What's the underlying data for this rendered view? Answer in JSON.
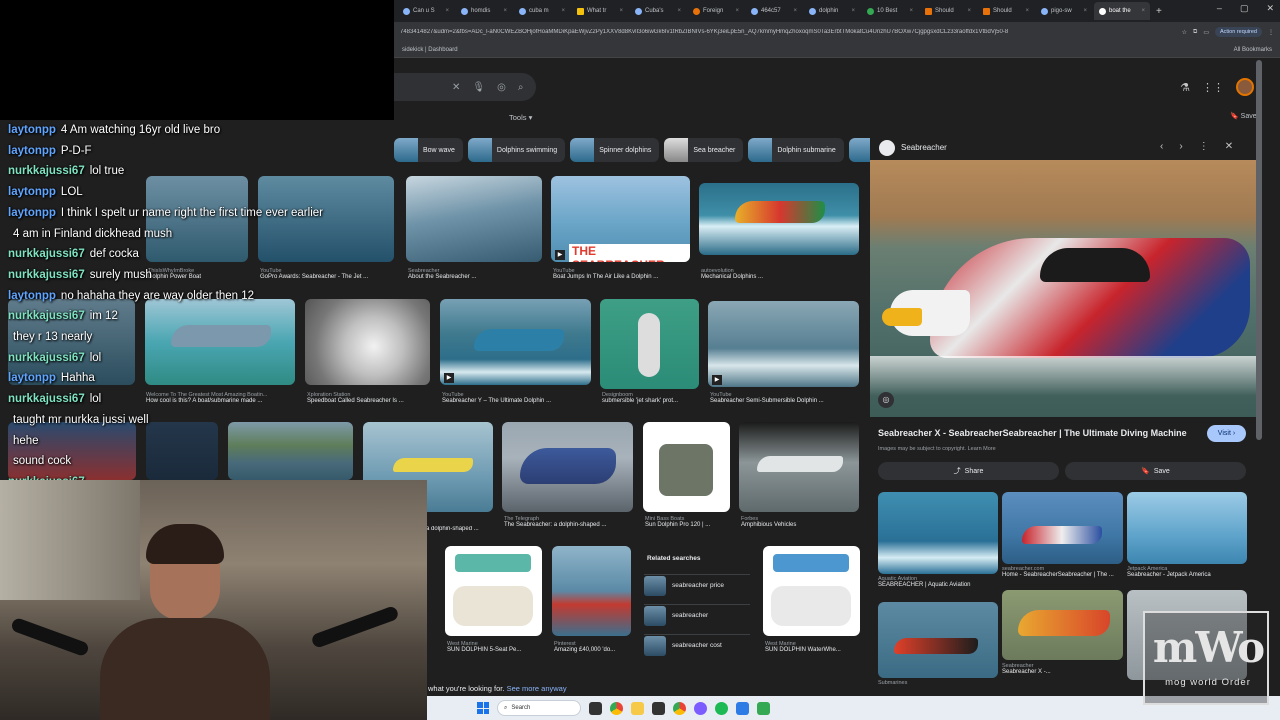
{
  "browser": {
    "tabs": [
      {
        "label": "Can u S"
      },
      {
        "label": "homdis"
      },
      {
        "label": "cuba m"
      },
      {
        "label": "What tr"
      },
      {
        "label": "Cuba's"
      },
      {
        "label": "Foreign"
      },
      {
        "label": "464c57"
      },
      {
        "label": "dolphin"
      },
      {
        "label": "10 Best"
      },
      {
        "label": "Should"
      },
      {
        "label": "Should"
      },
      {
        "label": "pigo-sw"
      },
      {
        "label": "boat the"
      }
    ],
    "url": "7483414827&udm=2&fbs=ADc_l-aN0CWEZBOHjofHoaMMDiKpaEWjvZ2Py1XXV8d8KvlI3o6iwGk6Iv1tRbZIBNIVs-6YKj3eiLpE5n_AQ7kmmyHmqZhoxoqmS0Ta3ErbtTMokatCu4UnzhU7BOXw7CjgpgsxdCLz33raoffdx1VtbdVj50-8",
    "action_required": "Action required",
    "bookmark_left": "sidekick | Dashboard",
    "bookmark_right": "All Bookmarks"
  },
  "google": {
    "tools_label": "Tools",
    "saves_label": "Saves",
    "chips": [
      {
        "label": "Bow wave"
      },
      {
        "label": "Dolphins swimming"
      },
      {
        "label": "Spinner dolphins"
      },
      {
        "label": "Sea breacher"
      },
      {
        "label": "Dolphin submarine"
      }
    ],
    "results": [
      {
        "source": "Seabreacher",
        "title": "About the Seabreacher ..."
      },
      {
        "source": "YouTube",
        "title": "Boat Jumps In The Air Like a Dolphin ...",
        "overlay": "THE SEABREACHER"
      },
      {
        "source": "autoevolution",
        "title": "Mechanical Dolphins ..."
      },
      {
        "source": "ThisIsWhyImBroke",
        "title": "Dolphin Power Boat"
      },
      {
        "source": "YouTube",
        "title": "GoPro Awards: Seabreacher - The Jet ..."
      },
      {
        "source": "Welcome To The Greatest Most Amazing Boatin...",
        "title": "How cool is this? A boat/submarine made ..."
      },
      {
        "source": "Xploration Station",
        "title": "Speedboat Called Seabreacher Is ..."
      },
      {
        "source": "YouTube",
        "title": "Seabreacher Y – The Ultimate Dolphin ..."
      },
      {
        "source": "Designboom",
        "title": "submersible 'jet shark' prot..."
      },
      {
        "source": "YouTube",
        "title": "Seabreacher Semi-Submersible Dolphin ..."
      },
      {
        "source": "",
        "title": "a dolphin-shaped ..."
      },
      {
        "source": "The Telegraph",
        "title": "The Seabreacher: a dolphin-shaped ..."
      },
      {
        "source": "Mini Bass Boats",
        "title": "Sun Dolphin Pro 120 | ..."
      },
      {
        "source": "Forbes",
        "title": "Amphibious Vehicles"
      },
      {
        "source": "West Marine",
        "title": "SUN DOLPHIN 5-Seat Pe..."
      },
      {
        "source": "Pinterest",
        "title": "Amazing £40,000 'do..."
      },
      {
        "source": "West Marine",
        "title": "SUN DOLPHIN WaterWhe..."
      }
    ],
    "related": {
      "heading": "Related searches",
      "items": [
        {
          "label": "seabreacher price"
        },
        {
          "label": "seabreacher"
        },
        {
          "label": "seabreacher cost"
        }
      ]
    },
    "footer_text": "what you're looking for.",
    "footer_link": "See more anyway"
  },
  "panel": {
    "site": "Seabreacher",
    "heading": "Seabreacher X - SeabreacherSeabreacher | The Ultimate Diving Machine",
    "visit_label": "Visit",
    "copyright": "Images may be subject to copyright. Learn More",
    "share_label": "Share",
    "save_label": "Save",
    "more": [
      {
        "source": "Aquatic Aviation",
        "title": "SEABREACHER | Aquatic Aviation"
      },
      {
        "source": "seabreacher.com",
        "title": "Home - SeabreacherSeabreacher | The ..."
      },
      {
        "source": "Jetpack America",
        "title": "Seabreacher - Jetpack America"
      },
      {
        "source": "Submarines",
        "title": ""
      },
      {
        "source": "Seabreacher",
        "title": "Seabreacher X -..."
      }
    ]
  },
  "taskbar": {
    "search_placeholder": "Search"
  },
  "chat": [
    {
      "user": "laytonpp",
      "msg": "4 Am watching 16yr old live bro",
      "color": "blue"
    },
    {
      "user": "laytonpp",
      "msg": "P-D-F",
      "color": "blue"
    },
    {
      "user": "nurkkajussi67",
      "msg": "lol true",
      "color": "green"
    },
    {
      "user": "laytonpp",
      "msg": "LOL",
      "color": "blue"
    },
    {
      "user": "laytonpp",
      "msg": "I think I spelt ur name right the first time ever earlier",
      "color": "blue"
    },
    {
      "user": "",
      "msg": "4 am in Finland dickhead mush",
      "color": "blue"
    },
    {
      "user": "nurkkajussi67",
      "msg": "def cocka",
      "color": "green"
    },
    {
      "user": "nurkkajussi67",
      "msg": "surely mush",
      "color": "green"
    },
    {
      "user": "laytonpp",
      "msg": "no hahaha they are way older then 12",
      "color": "blue"
    },
    {
      "user": "nurkkajussi67",
      "msg": "im 12",
      "color": "green"
    },
    {
      "user": "",
      "msg": "they r 13 nearly",
      "color": "blue"
    },
    {
      "user": "nurkkajussi67",
      "msg": "lol",
      "color": "green"
    },
    {
      "user": "laytonpp",
      "msg": "Hahha",
      "color": "blue"
    },
    {
      "user": "nurkkajussi67",
      "msg": "lol",
      "color": "green"
    },
    {
      "user": "",
      "msg": "taught mr nurkka jussi well",
      "color": "blue"
    },
    {
      "user": "",
      "msg": "hehe",
      "color": "blue"
    },
    {
      "user": "",
      "msg": "sound cock",
      "color": "blue"
    },
    {
      "user": "nurkkajussi67",
      "msg": "",
      "color": "green"
    }
  ],
  "overlay_logo": {
    "big": "mWo",
    "small": "mog world Order"
  }
}
